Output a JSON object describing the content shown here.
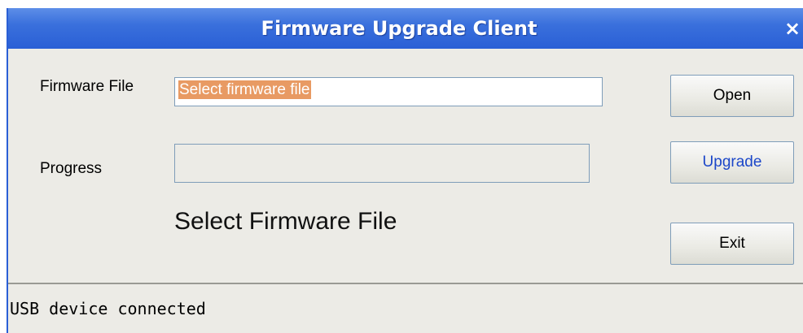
{
  "window": {
    "title": "Firmware Upgrade Client",
    "close_glyph": "×"
  },
  "form": {
    "firmware_label": "Firmware File",
    "firmware_value": "Select firmware file",
    "progress_label": "Progress",
    "progress_value": 0,
    "status_message": "Select Firmware File"
  },
  "buttons": {
    "open_label": "Open",
    "upgrade_label": "Upgrade",
    "exit_label": "Exit"
  },
  "statusbar": {
    "text": "USB device connected"
  },
  "colors": {
    "titlebar": "#2a5fd6",
    "selection_highlight": "#e89a63",
    "upgrade_label": "#1c47c9",
    "window_background": "#ecebe6"
  }
}
